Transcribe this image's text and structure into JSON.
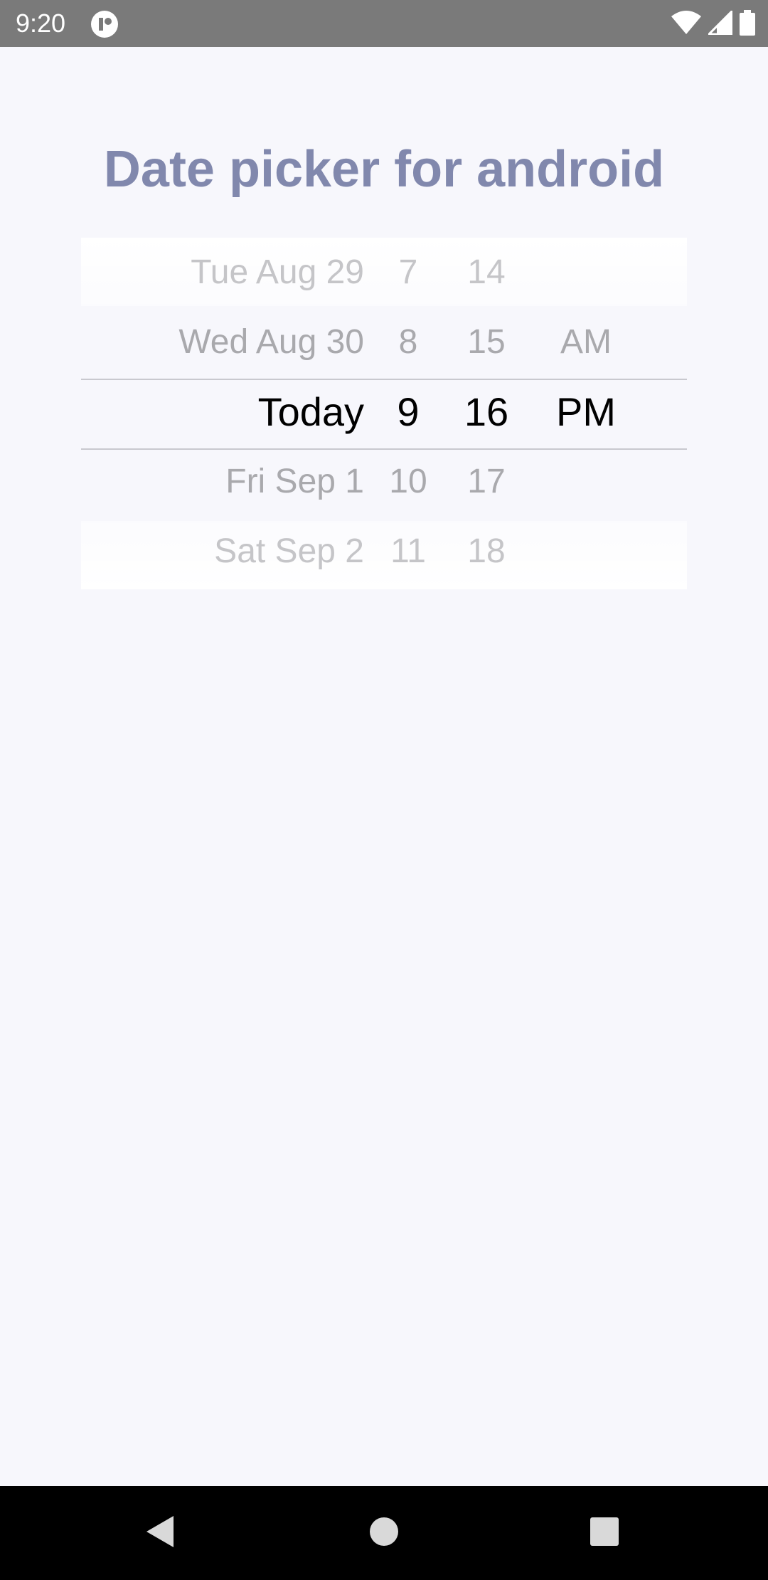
{
  "status_bar": {
    "time": "9:20",
    "icons": [
      "app-notification-icon",
      "wifi-icon",
      "cellular-signal-icon",
      "battery-icon"
    ]
  },
  "page": {
    "title": "Date picker for android"
  },
  "picker": {
    "dates": [
      "Tue Aug 29",
      "Wed Aug 30",
      "Today",
      "Fri Sep 1",
      "Sat Sep 2"
    ],
    "hours": [
      "7",
      "8",
      "9",
      "10",
      "11"
    ],
    "minutes": [
      "14",
      "15",
      "16",
      "17",
      "18"
    ],
    "ampm": [
      "",
      "AM",
      "PM",
      "",
      ""
    ],
    "selected": {
      "date": "Today",
      "hour": "9",
      "minute": "16",
      "ampm": "PM"
    }
  },
  "nav_bar": {
    "icons": [
      "back-icon",
      "home-icon",
      "recents-icon"
    ]
  },
  "colors": {
    "title": "#8188ad",
    "background": "#f7f7fc",
    "status_bar": "#7a7a7a",
    "nav_bar": "#000000",
    "selected_text": "#000000",
    "unselected_text": "#a9a9ad"
  }
}
